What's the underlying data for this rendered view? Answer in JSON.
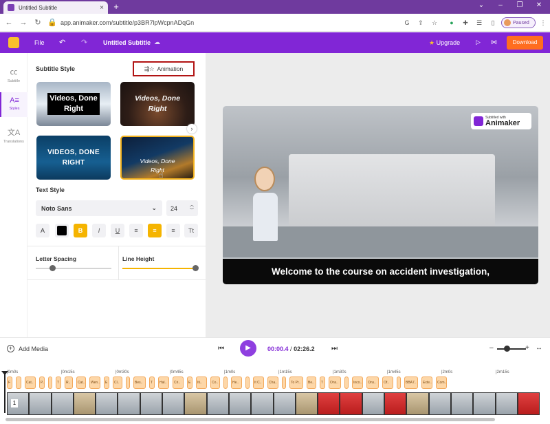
{
  "browser": {
    "tab_title": "Untitled Subtitle",
    "url": "app.animaker.com/subtitle/p3BR7lpWcpnADqGn",
    "profile_status": "Paused"
  },
  "header": {
    "file_label": "File",
    "project_title": "Untitled Subtitle",
    "upgrade_label": "Upgrade",
    "download_label": "Download"
  },
  "rail": {
    "items": [
      {
        "label": "Subtitle",
        "icon": "cc-icon"
      },
      {
        "label": "Styles",
        "icon": "text-style-icon"
      },
      {
        "label": "Translations",
        "icon": "translate-icon"
      }
    ]
  },
  "panel": {
    "subtitle_style_title": "Subtitle Style",
    "animation_label": "Animation",
    "cards": [
      {
        "line1": "Videos, Done",
        "line2": "Right"
      },
      {
        "line1": "Videos, Done",
        "line2": "Right"
      },
      {
        "line1": "VIDEOS, DONE",
        "line2": "RIGHT"
      },
      {
        "line1": "Videos, Done",
        "line2": "Right"
      }
    ],
    "text_style_title": "Text Style",
    "font_name": "Noto Sans",
    "font_size": "24",
    "letter_spacing_label": "Letter Spacing",
    "line_height_label": "Line Height",
    "letter_spacing_value": 0.2,
    "line_height_value": 1.0
  },
  "preview": {
    "badge_small": "Subtitled with",
    "badge_brand": "Animaker",
    "caption": "Welcome to the course on accident investigation,"
  },
  "playback": {
    "add_media_label": "Add Media",
    "current_time": "00:00.4",
    "separator": "/",
    "total_time": "02:26.2"
  },
  "timeline": {
    "ticks": [
      "0m0s",
      "0m15s",
      "0m30s",
      "0m45s",
      "1m0s",
      "1m15s",
      "1m30s",
      "1m45s",
      "2m0s",
      "2m15s"
    ],
    "first_scene_number": "1",
    "subtitle_blocks": [
      "F",
      "",
      "Cat..",
      "P..",
      "",
      "T",
      "R..",
      "Cat..",
      "Wen..",
      "E",
      "Cl..",
      "",
      "Bes..",
      "T",
      "Hal..",
      "Cri..",
      "E",
      "Iti..",
      "Co..",
      "",
      "He..",
      "",
      "It C..",
      "Cha..",
      "",
      "To Pr..",
      "Be..",
      "T",
      "Ons..",
      "",
      "Inco..",
      "Ons..",
      "Of..",
      "",
      "BBA7..",
      "Exte..",
      "Com.."
    ]
  },
  "colors": {
    "brand": "#8126d6",
    "accent": "#f5b400",
    "download": "#ff6d1f",
    "annotation_box": "#b11313"
  }
}
